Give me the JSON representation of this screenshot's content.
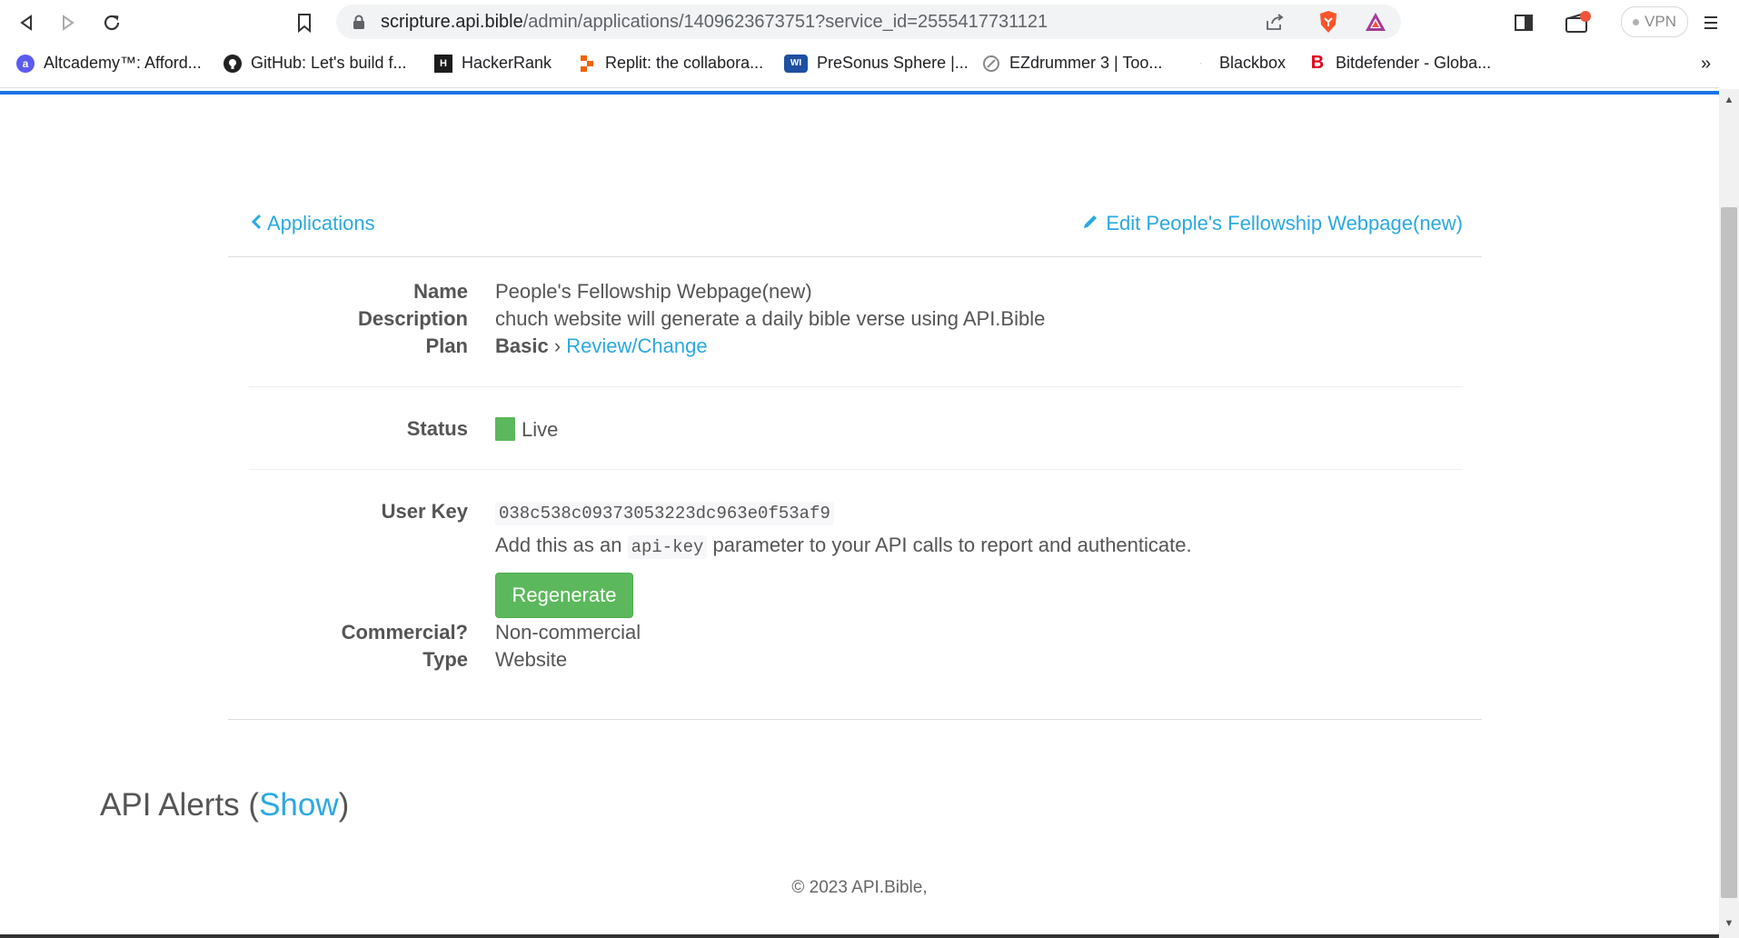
{
  "browser": {
    "url_host": "scripture.api.bible",
    "url_path": "/admin/applications/1409623673751?service_id=2555417731121",
    "vpn_label": "VPN",
    "bookmarks": [
      {
        "label": "Altcademy™: Afford...",
        "icon": "altcademy-icon",
        "color": "#5b5bf0"
      },
      {
        "label": "GitHub: Let's build f...",
        "icon": "github-icon",
        "color": "#222222"
      },
      {
        "label": "HackerRank",
        "icon": "hackerrank-icon",
        "color": "#1c1c1c"
      },
      {
        "label": "Replit: the collabora...",
        "icon": "replit-icon",
        "color": "#f26207"
      },
      {
        "label": "PreSonus Sphere |...",
        "icon": "presonus-icon",
        "color": "#1f4fa0"
      },
      {
        "label": "EZdrummer 3 | Too...",
        "icon": "ezdrummer-icon",
        "color": "#888888"
      },
      {
        "label": "Blackbox",
        "icon": "blackbox-icon",
        "color": "#cccccc"
      },
      {
        "label": "Bitdefender - Globa...",
        "icon": "bitdefender-icon",
        "color": "#e0001a"
      }
    ],
    "more_bookmarks": "»"
  },
  "page": {
    "back_link": "Applications",
    "edit_link": "Edit People's Fellowship Webpage(new)",
    "fields": {
      "name_label": "Name",
      "name_value": "People's Fellowship Webpage(new)",
      "description_label": "Description",
      "description_value": "chuch website will generate a daily bible verse using API.Bible",
      "plan_label": "Plan",
      "plan_value": "Basic",
      "plan_separator": "›",
      "plan_link": "Review/Change",
      "status_label": "Status",
      "status_value": "Live",
      "user_key_label": "User Key",
      "user_key_value": "038c538c09373053223dc963e0f53af9",
      "key_help_before": "Add this as an",
      "key_help_code": "api-key",
      "key_help_after": "parameter to your API calls to report and authenticate.",
      "regenerate_button": "Regenerate",
      "commercial_label": "Commercial?",
      "commercial_value": "Non-commercial",
      "type_label": "Type",
      "type_value": "Website"
    },
    "alerts": {
      "title": "API Alerts",
      "open_paren": "(",
      "show_link": "Show",
      "close_paren": ")"
    },
    "footer": "© 2023 API.Bible,"
  },
  "colors": {
    "link": "#2aa9e0",
    "live_status": "#5cb85c",
    "regenerate_bg": "#5cb85c"
  }
}
